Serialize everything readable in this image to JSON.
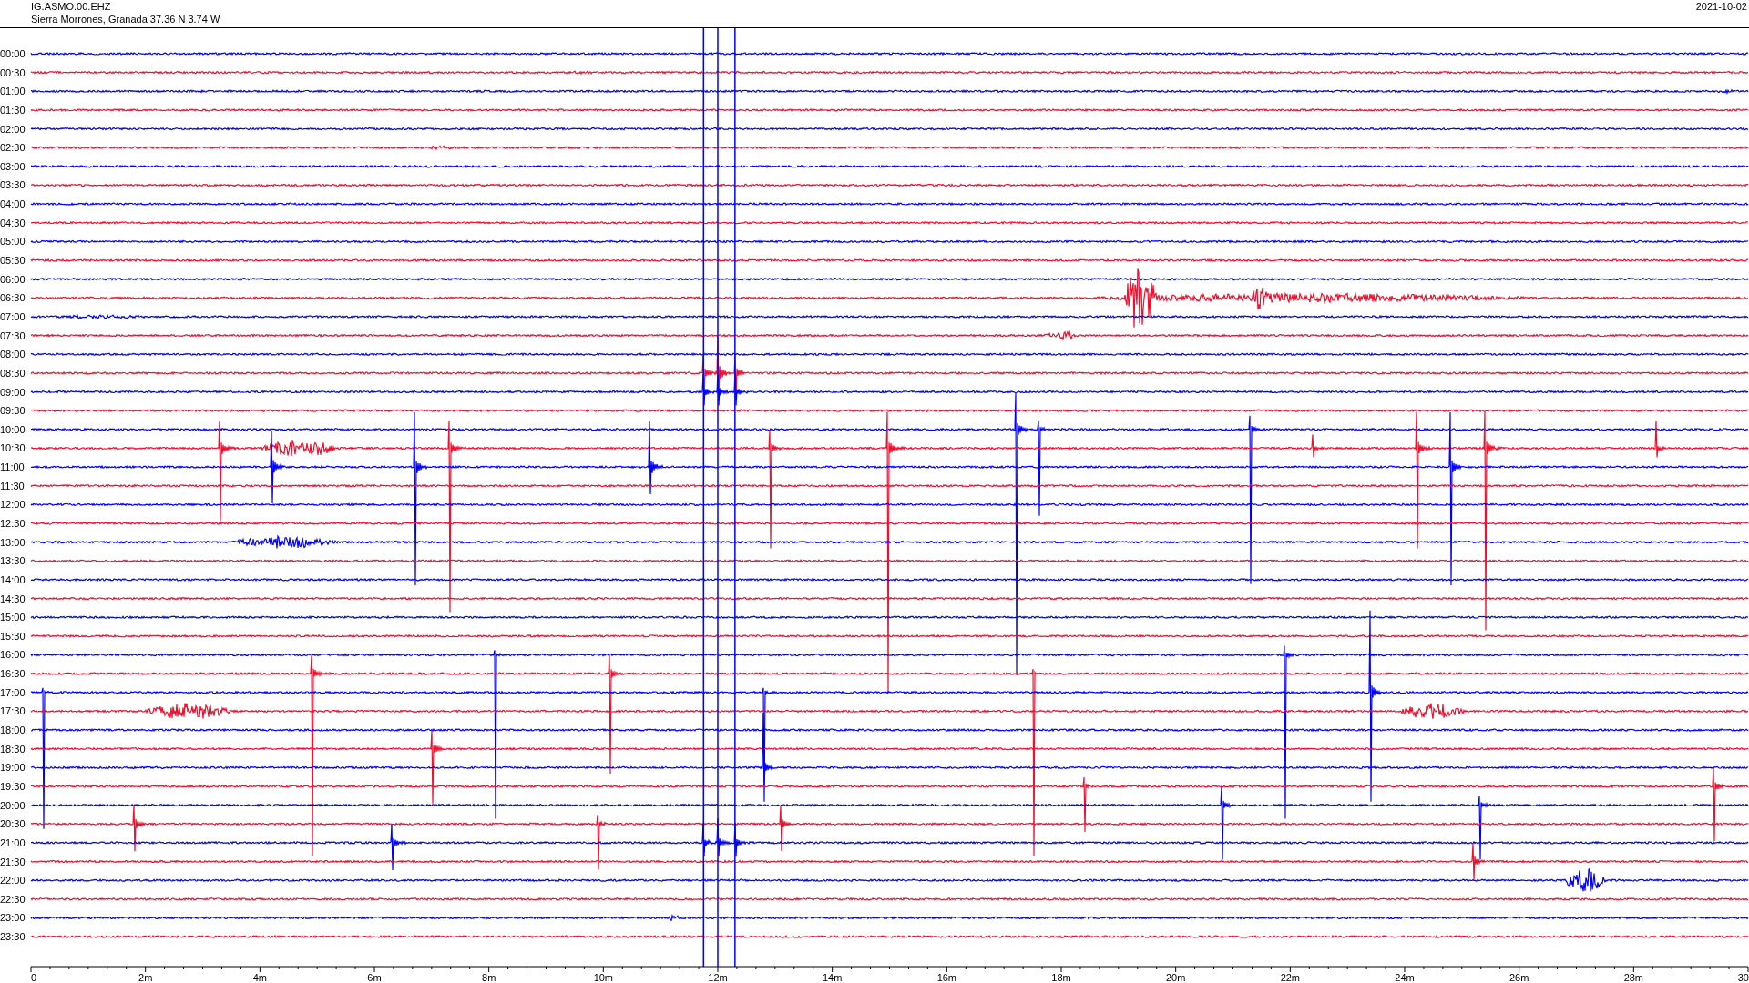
{
  "header": {
    "station_code": "IG.ASMO.00.EHZ",
    "location": "Sierra Morrones, Granada  37.36 N 3.74 W",
    "date": "2021-10-02"
  },
  "rows": [
    {
      "label": "00:00",
      "color": "#0000ff"
    },
    {
      "label": "00:30",
      "color": "#f0102e"
    },
    {
      "label": "01:00",
      "color": "#0000ff"
    },
    {
      "label": "01:30",
      "color": "#f0102e"
    },
    {
      "label": "02:00",
      "color": "#0000ff"
    },
    {
      "label": "02:30",
      "color": "#f0102e"
    },
    {
      "label": "03:00",
      "color": "#0000ff"
    },
    {
      "label": "03:30",
      "color": "#f0102e"
    },
    {
      "label": "04:00",
      "color": "#0000ff"
    },
    {
      "label": "04:30",
      "color": "#f0102e"
    },
    {
      "label": "05:00",
      "color": "#0000ff"
    },
    {
      "label": "05:30",
      "color": "#f0102e"
    },
    {
      "label": "06:00",
      "color": "#0000ff"
    },
    {
      "label": "06:30",
      "color": "#f0102e"
    },
    {
      "label": "07:00",
      "color": "#0000ff"
    },
    {
      "label": "07:30",
      "color": "#f0102e"
    },
    {
      "label": "08:00",
      "color": "#0000ff"
    },
    {
      "label": "08:30",
      "color": "#f0102e"
    },
    {
      "label": "09:00",
      "color": "#0000ff"
    },
    {
      "label": "09:30",
      "color": "#f0102e"
    },
    {
      "label": "10:00",
      "color": "#0000ff"
    },
    {
      "label": "10:30",
      "color": "#f0102e"
    },
    {
      "label": "11:00",
      "color": "#0000ff"
    },
    {
      "label": "11:30",
      "color": "#f0102e"
    },
    {
      "label": "12:00",
      "color": "#0000ff"
    },
    {
      "label": "12:30",
      "color": "#f0102e"
    },
    {
      "label": "13:00",
      "color": "#0000ff"
    },
    {
      "label": "13:30",
      "color": "#f0102e"
    },
    {
      "label": "14:00",
      "color": "#0000ff"
    },
    {
      "label": "14:30",
      "color": "#f0102e"
    },
    {
      "label": "15:00",
      "color": "#0000ff"
    },
    {
      "label": "15:30",
      "color": "#f0102e"
    },
    {
      "label": "16:00",
      "color": "#0000ff"
    },
    {
      "label": "16:30",
      "color": "#f0102e"
    },
    {
      "label": "17:00",
      "color": "#0000ff"
    },
    {
      "label": "17:30",
      "color": "#f0102e"
    },
    {
      "label": "18:00",
      "color": "#0000ff"
    },
    {
      "label": "18:30",
      "color": "#f0102e"
    },
    {
      "label": "19:00",
      "color": "#0000ff"
    },
    {
      "label": "19:30",
      "color": "#f0102e"
    },
    {
      "label": "20:00",
      "color": "#0000ff"
    },
    {
      "label": "20:30",
      "color": "#f0102e"
    },
    {
      "label": "21:00",
      "color": "#0000ff"
    },
    {
      "label": "21:30",
      "color": "#f0102e"
    },
    {
      "label": "22:00",
      "color": "#0000ff"
    },
    {
      "label": "22:30",
      "color": "#f0102e"
    },
    {
      "label": "23:00",
      "color": "#0000ff"
    },
    {
      "label": "23:30",
      "color": "#f0102e"
    }
  ],
  "x_axis": {
    "ticks": [
      "0",
      "2m",
      "4m",
      "6m",
      "8m",
      "10m",
      "12m",
      "14m",
      "16m",
      "18m",
      "20m",
      "22m",
      "24m",
      "26m",
      "28m",
      "30"
    ]
  }
}
